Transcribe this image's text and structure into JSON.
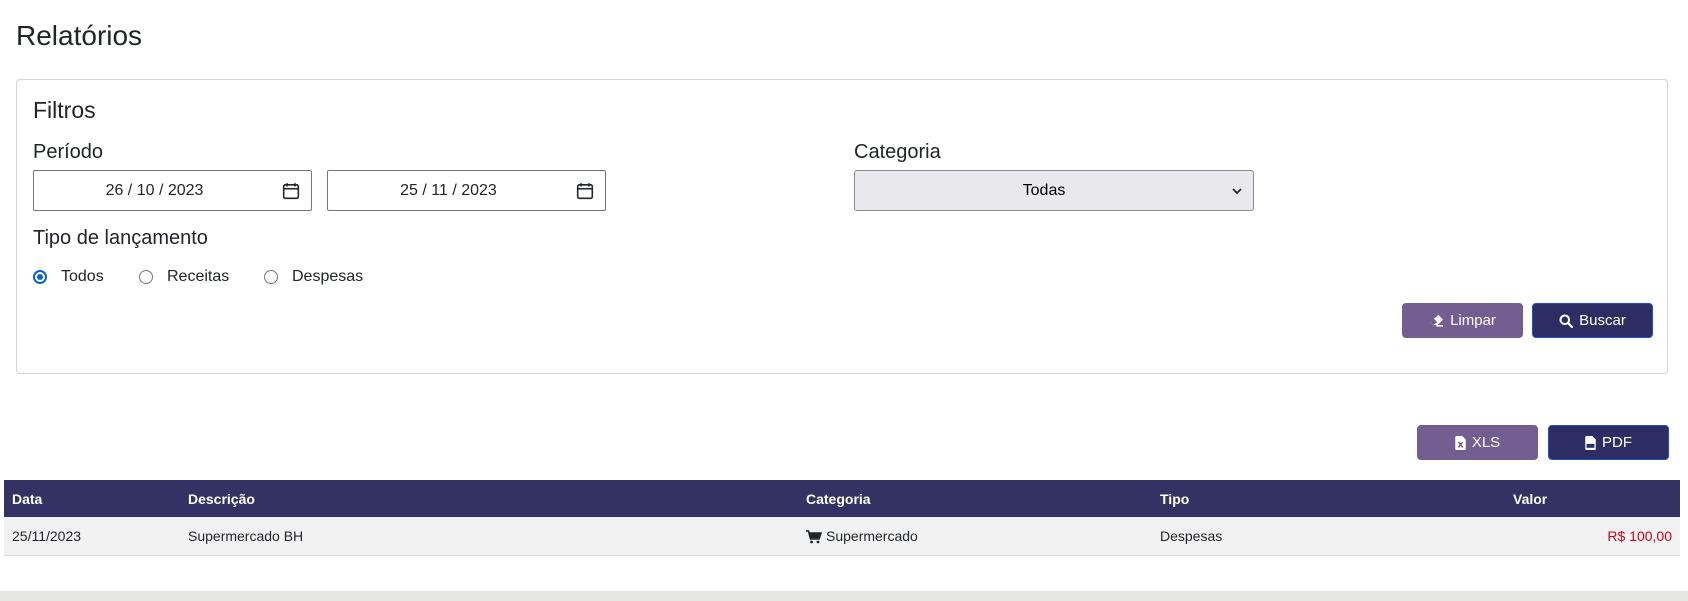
{
  "page": {
    "title": "Relatórios"
  },
  "filters": {
    "title": "Filtros",
    "period_label": "Período",
    "date_from": "26 / 10 / 2023",
    "date_to": "25 / 11 / 2023",
    "category_label": "Categoria",
    "category_selected": "Todas",
    "type_label": "Tipo de lançamento",
    "type_options": [
      {
        "label": "Todos",
        "checked": true
      },
      {
        "label": "Receitas",
        "checked": false
      },
      {
        "label": "Despesas",
        "checked": false
      }
    ],
    "clear_label": "Limpar",
    "search_label": "Buscar"
  },
  "export": {
    "xls_label": "XLS",
    "pdf_label": "PDF"
  },
  "table": {
    "headers": [
      "Data",
      "Descrição",
      "Categoria",
      "Tipo",
      "Valor"
    ],
    "rows": [
      {
        "date": "25/11/2023",
        "description": "Supermercado BH",
        "category": "Supermercado",
        "category_icon": "cart-icon",
        "type": "Despesas",
        "value": "R$ 100,00"
      }
    ]
  },
  "colors": {
    "primary": "#2e2d63",
    "secondary": "#735e91",
    "header_bg": "#343264",
    "expense": "#d0021b",
    "radio_accent": "#0b63ce"
  }
}
